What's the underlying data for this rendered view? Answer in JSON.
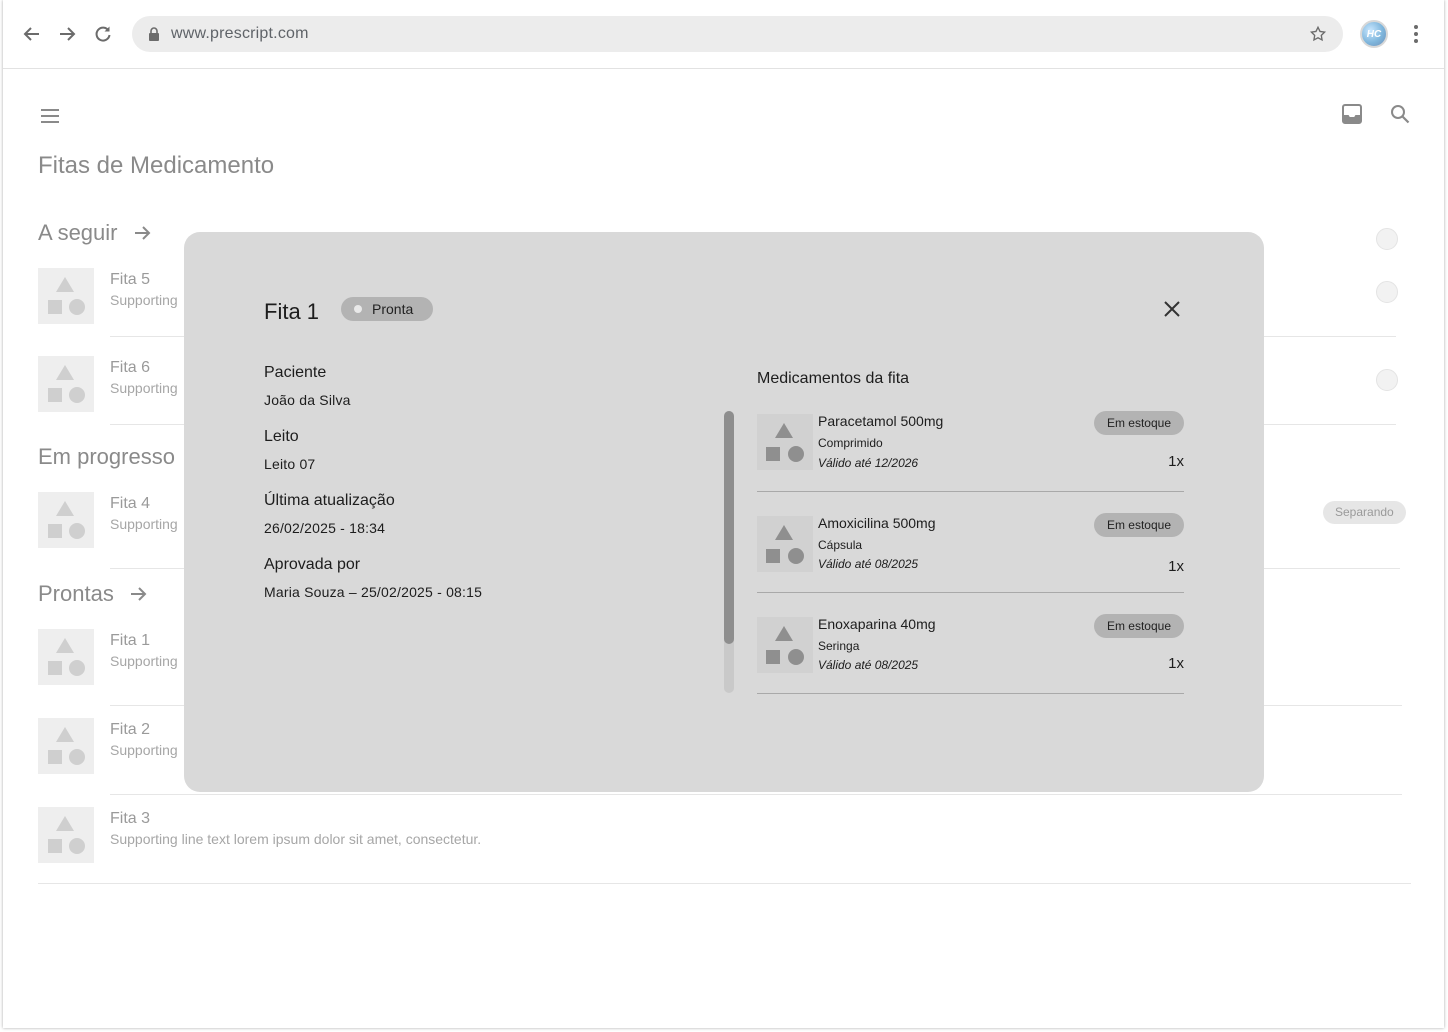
{
  "browser": {
    "url": "www.prescript.com",
    "avatar_initials": "HC",
    "icons": [
      "back-arrow-icon",
      "forward-arrow-icon",
      "reload-icon",
      "lock-icon",
      "star-icon",
      "more-vert-icon"
    ]
  },
  "app": {
    "page_title": "Fitas de Medicamento",
    "icons": [
      "menu-icon",
      "inbox-icon",
      "search-icon"
    ]
  },
  "sections": {
    "next": {
      "title": "A seguir"
    },
    "in_progress": {
      "title": "Em progresso"
    },
    "ready": {
      "title": "Prontas"
    }
  },
  "list": {
    "next": [
      {
        "title": "Fita 5",
        "subtitle": "Supporting"
      },
      {
        "title": "Fita 6",
        "subtitle": "Supporting"
      }
    ],
    "in_progress": [
      {
        "title": "Fita 4",
        "subtitle": "Supporting",
        "chip": "Separando"
      }
    ],
    "ready": [
      {
        "title": "Fita 1",
        "subtitle": "Supporting"
      },
      {
        "title": "Fita 2",
        "subtitle": "Supporting"
      },
      {
        "title": "Fita 3",
        "subtitle": "Supporting line text lorem ipsum dolor sit amet, consectetur."
      }
    ]
  },
  "dialog": {
    "title": "Fita 1",
    "status": "Pronta",
    "fields": [
      {
        "label": "Paciente",
        "value": "João da Silva"
      },
      {
        "label": "Leito",
        "value": "Leito 07"
      },
      {
        "label": "Última atualização",
        "value": "26/02/2025 - 18:34"
      },
      {
        "label": "Aprovada por",
        "value": "Maria Souza – 25/02/2025 - 08:15"
      }
    ],
    "meds_title": "Medicamentos da fita",
    "meds": [
      {
        "name": "Paracetamol 500mg",
        "form": "Comprimido",
        "validity": "Válido até 12/2026",
        "stock": "Em estoque",
        "qty": "1x"
      },
      {
        "name": "Amoxicilina 500mg",
        "form": "Cápsula",
        "validity": "Válido até 08/2025",
        "stock": "Em estoque",
        "qty": "1x"
      },
      {
        "name": "Enoxaparina 40mg",
        "form": "Seringa",
        "validity": "Válido até 08/2025",
        "stock": "Em estoque",
        "qty": "1x"
      }
    ],
    "scroll_fraction_visible": 0.83
  },
  "colors": {
    "dialog_bg": "#d9d9d9",
    "chip_bg": "#b3b3b3",
    "text": "#1d1d1d",
    "muted_text": "#9a9a9a"
  }
}
